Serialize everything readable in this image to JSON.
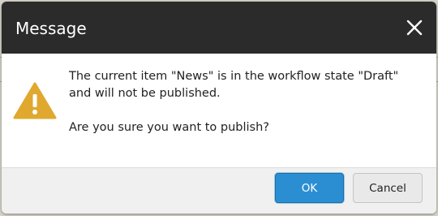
{
  "dialog": {
    "title": "Message",
    "message_line1": "The current item \"News\" is in the workflow state \"Draft\"",
    "message_line2": "and will not be published.",
    "question": "Are you sure you want to publish?",
    "ok_label": "OK",
    "cancel_label": "Cancel"
  },
  "icons": {
    "close": "close-icon",
    "warning": "warning-icon"
  },
  "colors": {
    "titlebar": "#2b2b2b",
    "warning": "#e0a82e",
    "primary_button": "#2b8ed2",
    "secondary_button": "#e9e9e9"
  }
}
